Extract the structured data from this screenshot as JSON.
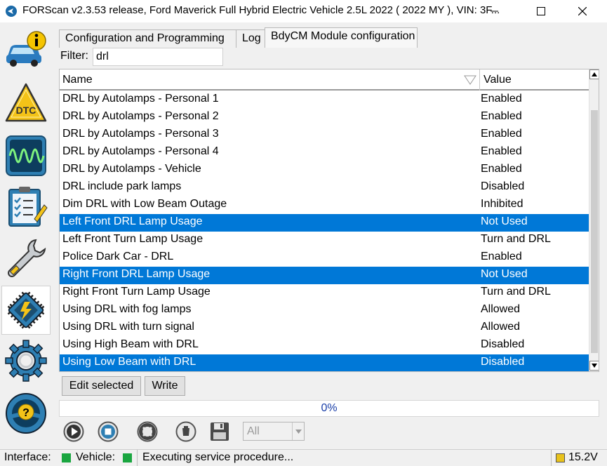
{
  "window": {
    "title": "FORScan v2.3.53 release, Ford Maverick Full Hybrid Electric Vehicle 2.5L 2022 ( 2022 MY ), VIN: 3F..."
  },
  "sidebar": {
    "items": [
      {
        "icon": "vehicle-info-icon"
      },
      {
        "icon": "dtc-icon",
        "label": "DTC"
      },
      {
        "icon": "oscilloscope-icon"
      },
      {
        "icon": "checklist-icon"
      },
      {
        "icon": "wrench-icon"
      },
      {
        "icon": "module-config-icon",
        "active": true
      },
      {
        "icon": "settings-gear-icon"
      },
      {
        "icon": "help-steering-icon",
        "label": "?"
      }
    ]
  },
  "tabs": [
    {
      "label": "Configuration and Programming"
    },
    {
      "label": "Log"
    },
    {
      "label": "BdyCM Module configuration",
      "active": true
    }
  ],
  "filter": {
    "label": "Filter:",
    "value": "drl"
  },
  "grid": {
    "columns": {
      "name": "Name",
      "value": "Value"
    },
    "rows": [
      {
        "name": "DRL by Autolamps - Personal 1",
        "value": "Enabled",
        "selected": false
      },
      {
        "name": "DRL by Autolamps - Personal 2",
        "value": "Enabled",
        "selected": false
      },
      {
        "name": "DRL by Autolamps - Personal 3",
        "value": "Enabled",
        "selected": false
      },
      {
        "name": "DRL by Autolamps - Personal 4",
        "value": "Enabled",
        "selected": false
      },
      {
        "name": "DRL by Autolamps - Vehicle",
        "value": "Enabled",
        "selected": false
      },
      {
        "name": "DRL include park lamps",
        "value": "Disabled",
        "selected": false
      },
      {
        "name": "Dim DRL with Low Beam Outage",
        "value": "Inhibited",
        "selected": false
      },
      {
        "name": "Left Front DRL Lamp Usage",
        "value": "Not Used",
        "selected": true
      },
      {
        "name": "Left Front Turn Lamp Usage",
        "value": "Turn and DRL",
        "selected": false
      },
      {
        "name": "Police Dark Car - DRL",
        "value": "Enabled",
        "selected": false
      },
      {
        "name": "Right Front DRL Lamp Usage",
        "value": "Not Used",
        "selected": true
      },
      {
        "name": "Right Front Turn Lamp Usage",
        "value": "Turn and DRL",
        "selected": false
      },
      {
        "name": "Using DRL with fog lamps",
        "value": "Allowed",
        "selected": false
      },
      {
        "name": "Using DRL with turn signal",
        "value": "Allowed",
        "selected": false
      },
      {
        "name": "Using High Beam with DRL",
        "value": "Disabled",
        "selected": false
      },
      {
        "name": "Using Low Beam with DRL",
        "value": "Disabled",
        "selected": true
      }
    ]
  },
  "buttons": {
    "edit_selected": "Edit selected",
    "write": "Write"
  },
  "progress": {
    "text": "0%",
    "value": 0
  },
  "controls": {
    "icons": [
      "play-icon",
      "stop-icon",
      "lifebuoy-icon",
      "clear-icon",
      "save-icon"
    ],
    "select_value": "All"
  },
  "status": {
    "interface_label": "Interface:",
    "vehicle_label": "Vehicle:",
    "message": "Executing service procedure...",
    "voltage": "15.2V",
    "colors": {
      "interface": "#1aa640",
      "vehicle": "#1aa640",
      "voltage": "#e8c21c"
    }
  },
  "colors": {
    "selection": "#0078d7",
    "progress_text": "#1a3fa8"
  }
}
